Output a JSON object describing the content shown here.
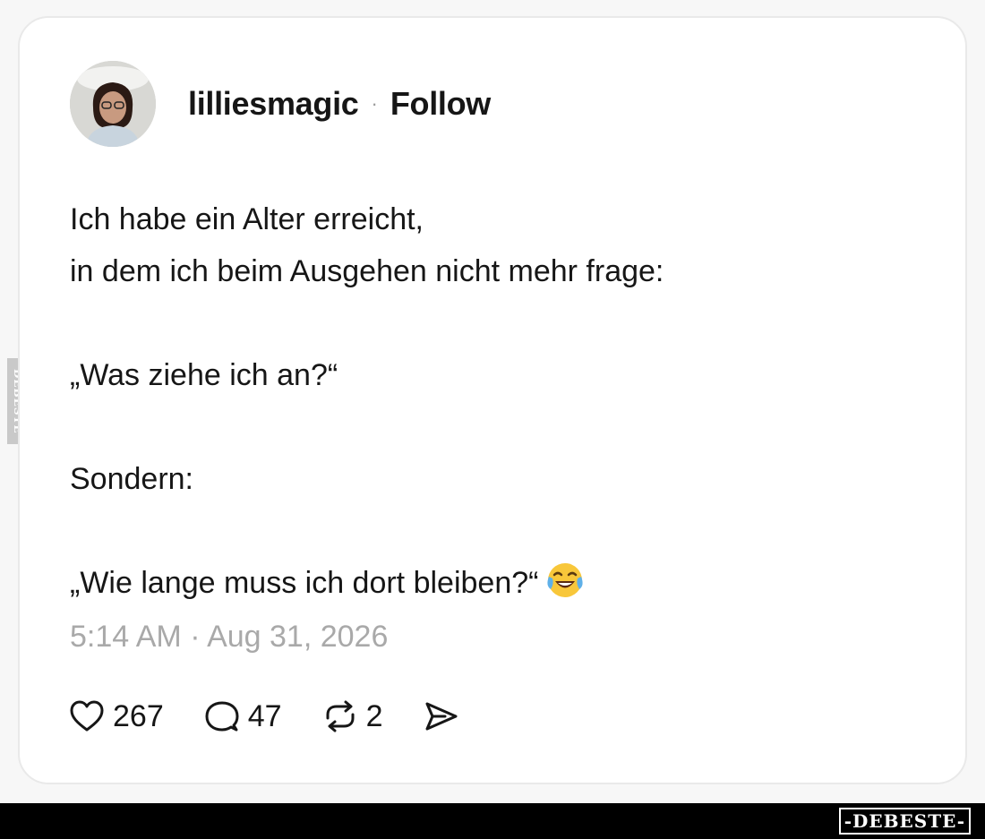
{
  "post": {
    "username": "lilliesmagic",
    "separator": "·",
    "follow_label": "Follow",
    "lines": {
      "l1": "Ich habe ein Alter erreicht,",
      "l2": "in dem ich beim Ausgehen nicht mehr frage:",
      "l3": "„Was ziehe ich an?“",
      "l4": "Sondern:",
      "l5": "„Wie lange muss ich dort bleiben?“"
    },
    "emoji": "face-with-tears-of-joy",
    "timestamp": "5:14 AM · Aug 31, 2026"
  },
  "actions": {
    "likes": "267",
    "replies": "47",
    "reposts": "2"
  },
  "icons": {
    "like": "heart-icon",
    "reply": "comment-bubble-icon",
    "repost": "repost-icon",
    "share": "send-icon"
  },
  "watermark": {
    "logo": "-DEBESTE-",
    "side": "DEBESTE"
  },
  "colors": {
    "text": "#161616",
    "muted": "#a9a9a9",
    "card_border": "#e9e9e9",
    "footer": "#000000"
  }
}
